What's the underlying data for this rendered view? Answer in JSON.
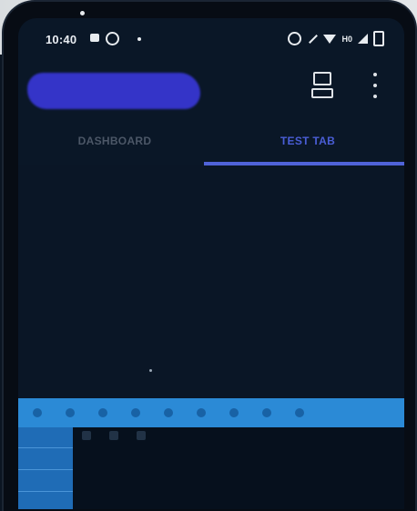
{
  "status_bar": {
    "time": "10:40",
    "left_icons": [
      "message-icon",
      "whatsapp-icon",
      "notification-dot-icon"
    ],
    "right_icons": [
      "alarm-icon",
      "mute-icon",
      "signal-icon",
      "wifi-icon",
      "hd-icon",
      "cellular-icon",
      "battery-icon"
    ],
    "network_label": "H0"
  },
  "app_bar": {
    "title_redacted": true,
    "actions": [
      "device-icon",
      "more-vert-icon"
    ]
  },
  "tabs": [
    {
      "label": "DASHBOARD",
      "selected": false
    },
    {
      "label": "TEST TAB",
      "selected": true
    }
  ],
  "colors": {
    "accent": "#5063d8",
    "background": "#0a1727",
    "title_redaction": "#3434c8",
    "bottom_strip": "#2b8ad6"
  }
}
